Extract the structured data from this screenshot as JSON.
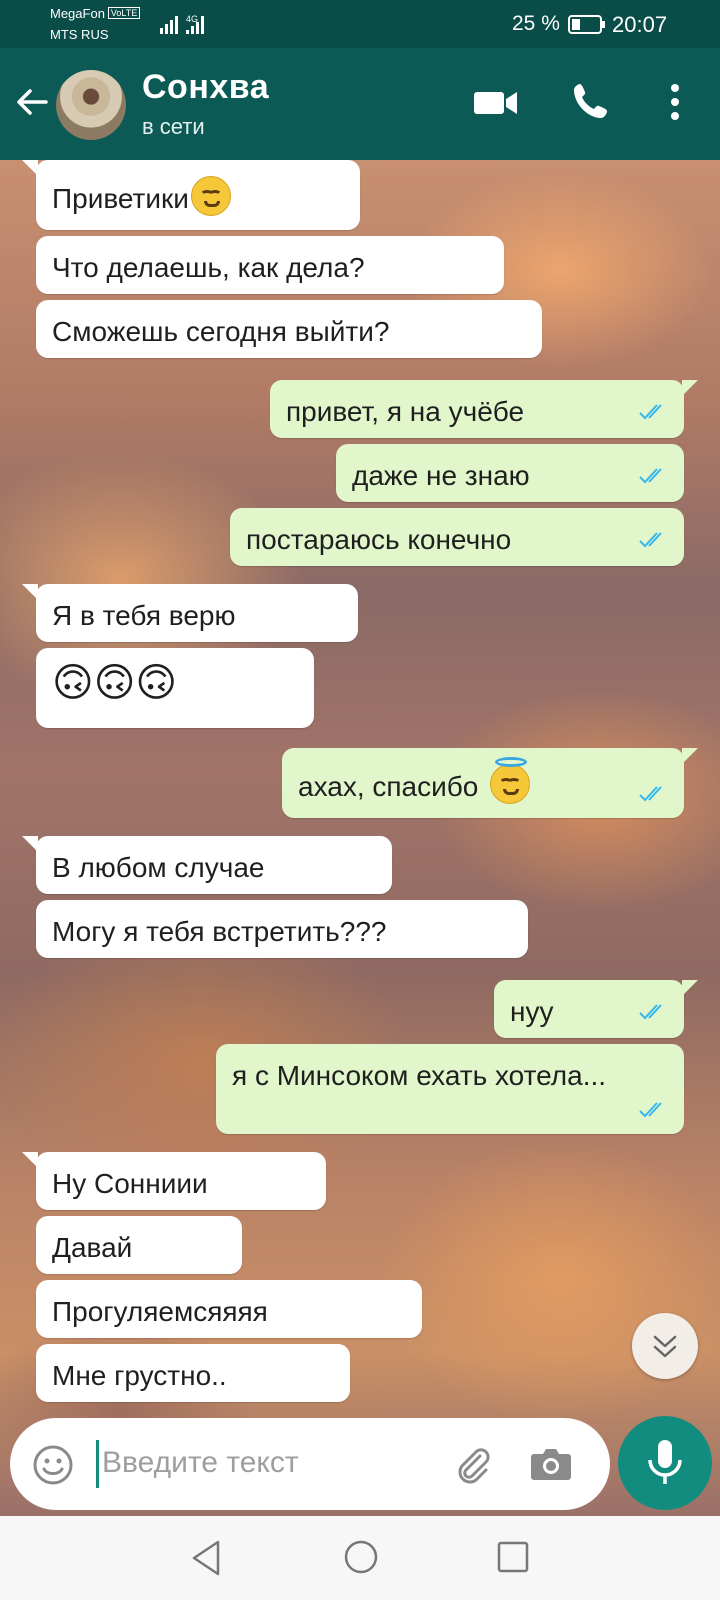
{
  "status_bar": {
    "carrier1": "MegaFon",
    "volte": "VoLTE",
    "carrier2": "MTS RUS",
    "network": "4G",
    "battery": "25 %",
    "time": "20:07"
  },
  "header": {
    "contact_name": "Сонхва",
    "status": "в сети"
  },
  "messages": [
    {
      "dir": "in",
      "text": "Приветики"
    },
    {
      "dir": "in",
      "text": "Что делаешь, как дела?"
    },
    {
      "dir": "in",
      "text": "Сможешь сегодня выйти?"
    },
    {
      "dir": "out",
      "text": "привет, я на учёбе"
    },
    {
      "dir": "out",
      "text": "даже не знаю"
    },
    {
      "dir": "out",
      "text": "постараюсь конечно"
    },
    {
      "dir": "in",
      "text": "Я в тебя верю"
    },
    {
      "dir": "in",
      "text": "🙃🙃🙃"
    },
    {
      "dir": "out",
      "text": "ахах, спасибо"
    },
    {
      "dir": "in",
      "text": "В любом случае"
    },
    {
      "dir": "in",
      "text": "Могу я тебя встретить???"
    },
    {
      "dir": "out",
      "text": "нуу"
    },
    {
      "dir": "out",
      "text": "я с Минсоком ехать хотела..."
    },
    {
      "dir": "in",
      "text": "Ну Сонниии"
    },
    {
      "dir": "in",
      "text": "Давай"
    },
    {
      "dir": "in",
      "text": "Прогуляемсяяяя"
    },
    {
      "dir": "in",
      "text": "Мне грустно.."
    }
  ],
  "input": {
    "placeholder": "Введите текст"
  },
  "colors": {
    "header": "#0b5a55",
    "outgoing_bubble": "#e1f7cb",
    "incoming_bubble": "#ffffff",
    "read_ticks": "#34b7f1",
    "accent": "#128c7e"
  }
}
